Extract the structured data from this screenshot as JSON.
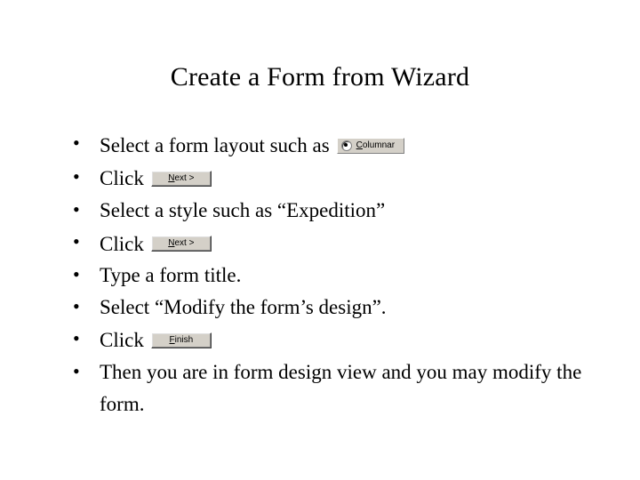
{
  "title": "Create a Form from Wizard",
  "bullets": {
    "b1_text": "Select a form layout such as",
    "b2_text": "Click",
    "b3_text": "Select a style such as “Expedition”",
    "b4_text": "Click",
    "b5_text": "Type a form title.",
    "b6_text": "Select “Modify the form’s design”.",
    "b7_text": "Click",
    "b8_text": "Then  you are in form design view and you may modify the form."
  },
  "widgets": {
    "columnar_prefix": "C",
    "columnar_rest": "olumnar",
    "next_prefix": "N",
    "next_rest": "ext >",
    "finish_prefix": "F",
    "finish_rest": "inish"
  }
}
